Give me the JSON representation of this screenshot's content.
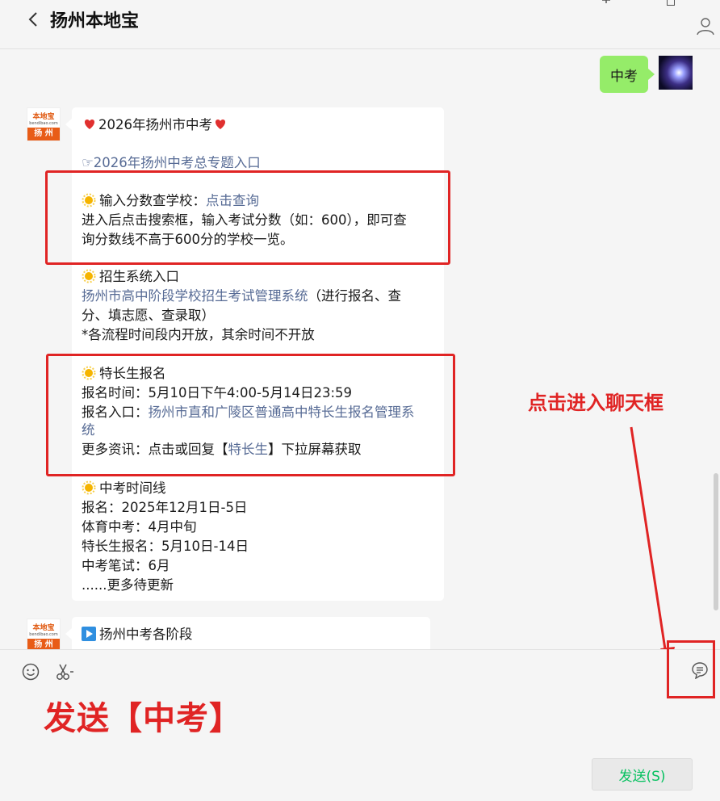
{
  "header": {
    "title": "扬州本地宝"
  },
  "chat": {
    "my_message": "中考",
    "article1": {
      "avatar": {
        "top": "本地宝",
        "mid": "bendibao.com",
        "bar": "扬 州"
      },
      "title": "2026年扬州市中考",
      "special_topic_link": "☞2026年扬州中考总专题入口",
      "score_query_label": "输入分数查学校：",
      "score_query_link": "点击查询",
      "score_desc_line1": "进入后点击搜索框，输入考试分数（如：600），即可查",
      "score_desc_line2": "询分数线不高于600分的学校一览。",
      "enroll_system_title": "招生系统入口",
      "enroll_system_link": "扬州市高中阶段学校招生考试管理系统",
      "enroll_system_suffix": "（进行报名、查",
      "enroll_system_line2": "分、填志愿、查录取）",
      "enroll_system_note": "*各流程时间段内开放，其余时间不开放",
      "special_talent_title": "特长生报名",
      "special_talent_time": "报名时间：5月10日下午4:00-5月14日23:59",
      "special_talent_entry_label": "报名入口：",
      "special_talent_entry_link1": "扬州市直和广陵区普通高中特长生报名管理系",
      "special_talent_entry_link2": "统",
      "special_talent_more_prefix": "更多资讯：点击或回复【",
      "special_talent_more_link": "特长生",
      "special_talent_more_suffix": "】下拉屏幕获取",
      "timeline_title": "中考时间线",
      "timeline_items": [
        "报名：2025年12月1日-5日",
        "体育中考：4月中旬",
        "特长生报名：5月10日-14日",
        "中考笔试：6月",
        "......更多待更新"
      ]
    },
    "article2": {
      "avatar": {
        "top": "本地宝",
        "mid": "bendibao.com",
        "bar": "扬 州"
      },
      "title": "扬州中考各阶段"
    }
  },
  "annotations": {
    "click_hint": "点击进入聊天框",
    "send_instruction": "发送【中考】"
  },
  "composer": {
    "send_label": "发送(S)"
  },
  "colors": {
    "annotation_red": "#e02424",
    "link_blue": "#576b95",
    "my_bubble_green": "#95ec69",
    "send_text_green": "#07c160"
  }
}
